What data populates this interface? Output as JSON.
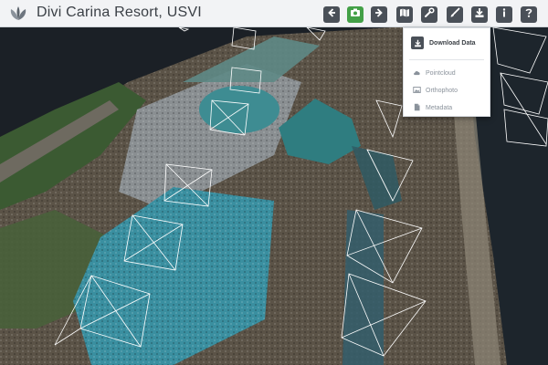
{
  "app": {
    "title": "Divi Carina Resort, USVI"
  },
  "toolbar": {
    "tools": [
      {
        "name": "back-icon",
        "active": false
      },
      {
        "name": "camera-icon",
        "active": true
      },
      {
        "name": "forward-icon",
        "active": false
      },
      {
        "name": "map-icon",
        "active": false
      },
      {
        "name": "wrench-icon",
        "active": false
      },
      {
        "name": "brush-icon",
        "active": false
      },
      {
        "name": "download-icon",
        "active": false
      },
      {
        "name": "info-icon",
        "active": false
      },
      {
        "name": "help-icon",
        "active": false
      }
    ]
  },
  "download_menu": {
    "header": "Download Data",
    "items": [
      {
        "label": "Pointcloud",
        "icon": "cloud-icon"
      },
      {
        "label": "Orthophoto",
        "icon": "image-icon"
      },
      {
        "label": "Metadata",
        "icon": "file-icon"
      }
    ]
  },
  "colors": {
    "topbar_bg": "#f2f3f5",
    "button_bg": "#4a5058",
    "button_active": "#43a047",
    "viewport_bg": "#1b2026"
  }
}
